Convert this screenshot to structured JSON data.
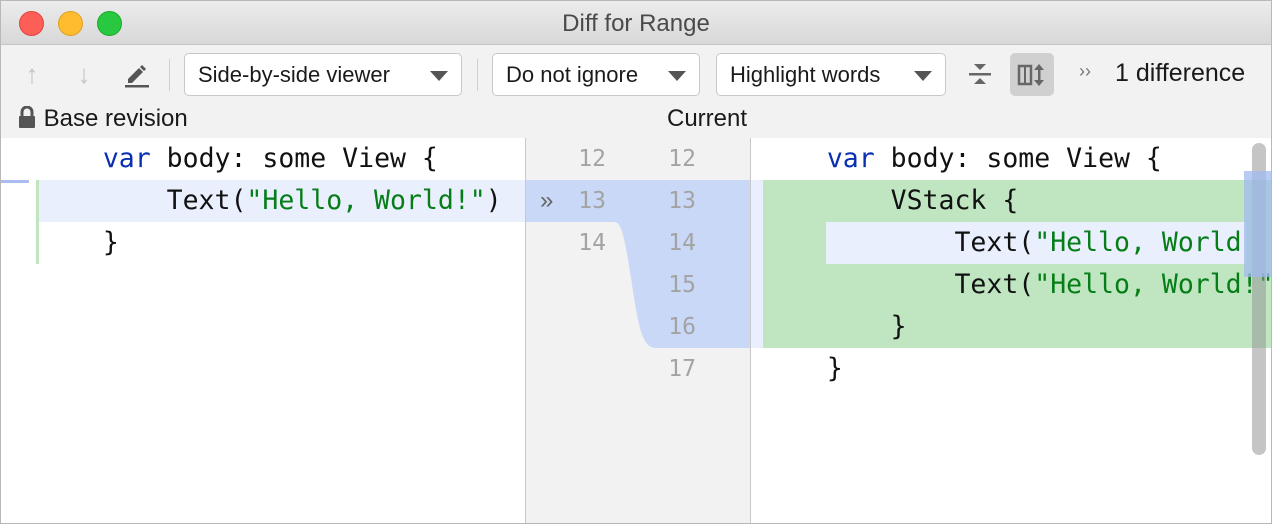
{
  "window": {
    "title": "Diff for Range"
  },
  "toolbar": {
    "prev_icon": "arrow-up-icon",
    "next_icon": "arrow-down-icon",
    "edit_icon": "pencil-icon",
    "viewer_select": "Side-by-side viewer",
    "ignore_select": "Do not ignore",
    "highlight_select": "Highlight words",
    "collapse_icon": "collapse-unchanged-icon",
    "sync_scroll_icon": "sync-scroll-icon",
    "more_icon": "double-chevron-icon",
    "differences": "1 difference"
  },
  "left": {
    "header": "Base revision",
    "lines": [
      {
        "num": "12",
        "parts": [
          "    ",
          "var",
          " body: some View {"
        ]
      },
      {
        "num": "13",
        "parts": [
          "        Text(",
          "\"Hello, World!\"",
          ")"
        ]
      },
      {
        "num": "14",
        "text": "    }"
      }
    ]
  },
  "right": {
    "header": "Current",
    "lines": [
      {
        "num": "12",
        "parts": [
          "    ",
          "var",
          " body: some View {"
        ]
      },
      {
        "num": "13",
        "text": "        VStack {"
      },
      {
        "num": "14",
        "parts": [
          "            Text(",
          "\"Hello, World"
        ]
      },
      {
        "num": "15",
        "parts": [
          "            Text(",
          "\"Hello, World!\""
        ]
      },
      {
        "num": "16",
        "text": "        }"
      },
      {
        "num": "17",
        "text": "    }"
      }
    ]
  },
  "colors": {
    "inserted": "#bfe6c0",
    "modified": "#c9d8f7",
    "caret_row": "#e9effd",
    "keyword": "#0a2fb0",
    "string": "#067d17"
  }
}
